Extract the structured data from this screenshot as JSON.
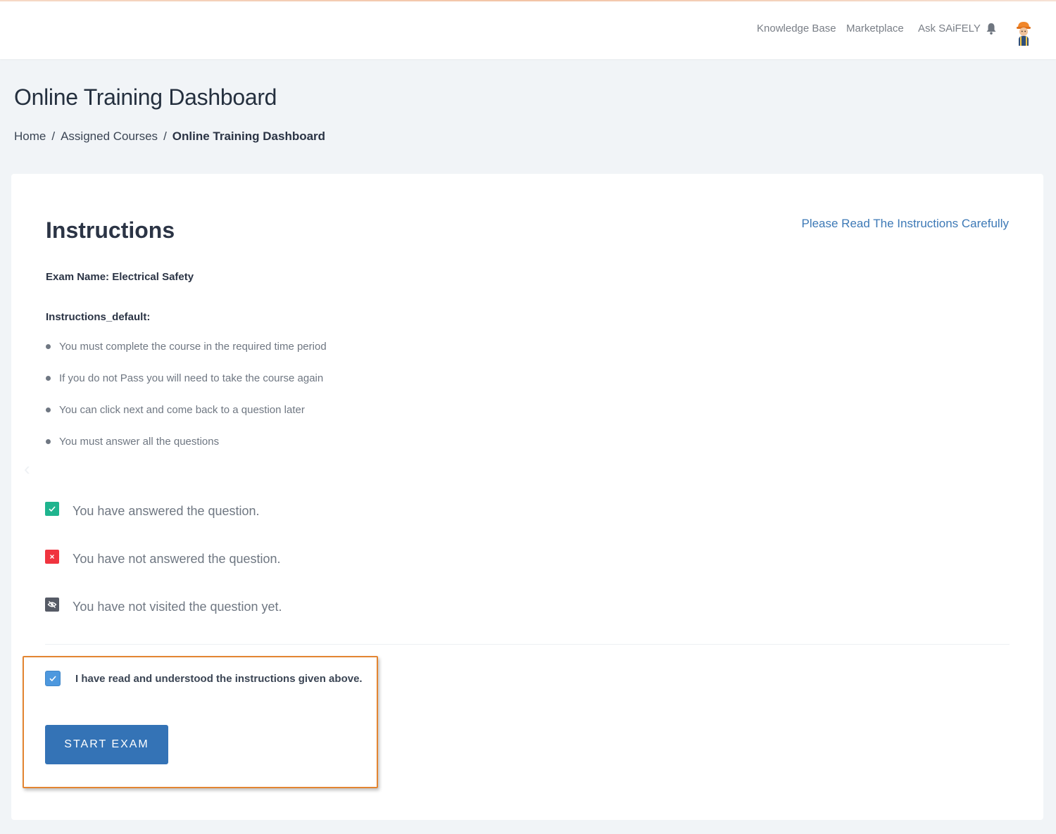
{
  "header": {
    "nav": [
      {
        "label": "Knowledge Base",
        "icon": null
      },
      {
        "label": "Marketplace",
        "icon": null
      },
      {
        "label": "Ask SAiFELY",
        "icon": null
      }
    ],
    "notification_icon": "bell-icon",
    "avatar_icon": "worker-avatar-icon"
  },
  "page": {
    "title": "Online Training Dashboard",
    "breadcrumb": [
      "Home",
      "Assigned Courses",
      "Online Training Dashboard"
    ]
  },
  "card": {
    "title": "Instructions",
    "note": "Please Read The Instructions Carefully",
    "exam_name": "Exam Name: Electrical Safety",
    "instructions_heading": "Instructions_default:",
    "instructions": [
      "You must complete the course in the required time period",
      "If you do not Pass you will need to take the course again",
      "You can click next and come back to a question later",
      "You must answer all the questions"
    ],
    "legend": [
      {
        "icon": "check-icon",
        "color": "#1fb48e",
        "text": "You have answered the question."
      },
      {
        "icon": "cross-icon",
        "color": "#f0343f",
        "text": "You have not answered the question."
      },
      {
        "icon": "eye-off-icon",
        "color": "#565b66",
        "text": "You have not visited the question yet."
      }
    ],
    "acknowledgement": {
      "label": "I have read and understood the instructions given above.",
      "checked": true
    },
    "start_button": "START EXAM"
  },
  "colors": {
    "accent": "#3473b6",
    "highlight_border": "#e38531",
    "link": "#3d79b6"
  }
}
